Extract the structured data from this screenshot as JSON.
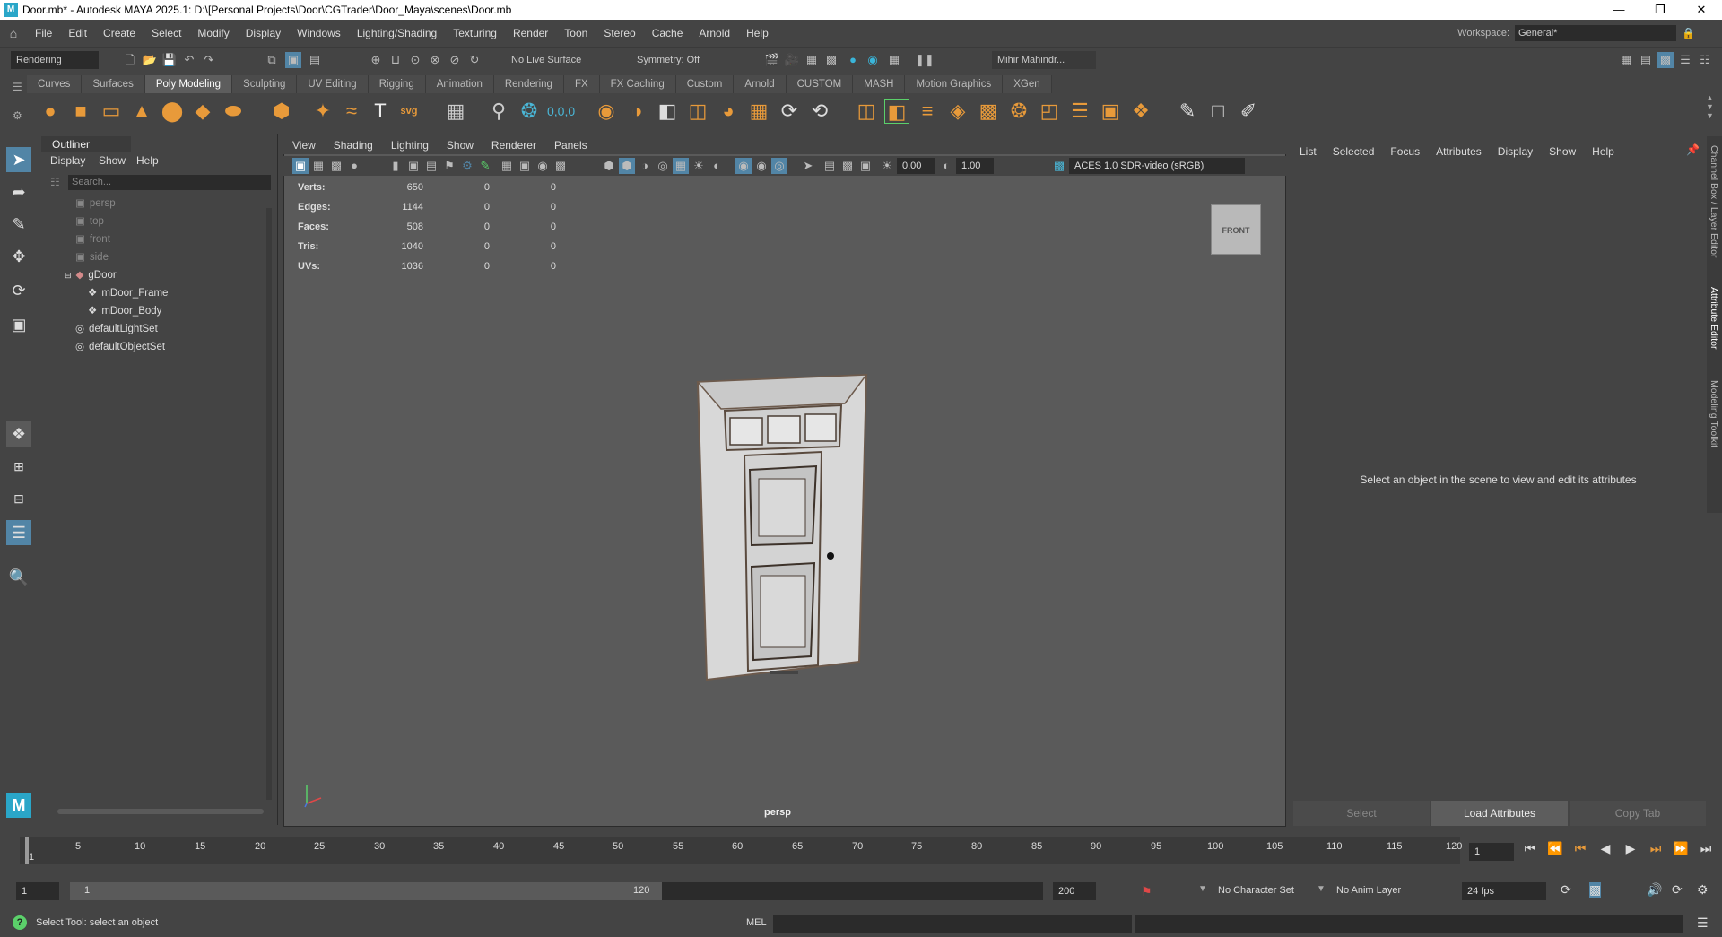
{
  "title": "Door.mb* - Autodesk MAYA 2025.1: D:\\[Personal Projects\\Door\\CGTrader\\Door_Maya\\scenes\\Door.mb",
  "menus": [
    "File",
    "Edit",
    "Create",
    "Select",
    "Modify",
    "Display",
    "Windows",
    "Lighting/Shading",
    "Texturing",
    "Render",
    "Toon",
    "Stereo",
    "Cache",
    "Arnold",
    "Help"
  ],
  "workspace": {
    "label": "Workspace:",
    "value": "General*"
  },
  "status": {
    "menuset": "Rendering",
    "live_surface": "No Live Surface",
    "symmetry": "Symmetry: Off",
    "user": "Mihir Mahindr..."
  },
  "shelf_tabs": [
    "Curves",
    "Surfaces",
    "Poly Modeling",
    "Sculpting",
    "UV Editing",
    "Rigging",
    "Animation",
    "Rendering",
    "FX",
    "FX Caching",
    "Custom",
    "Arnold",
    "CUSTOM",
    "MASH",
    "Motion Graphics",
    "XGen"
  ],
  "shelf_active": "Poly Modeling",
  "outliner": {
    "title": "Outliner",
    "menus": [
      "Display",
      "Show",
      "Help"
    ],
    "search_placeholder": "Search...",
    "items": [
      {
        "label": "persp",
        "dim": true
      },
      {
        "label": "top",
        "dim": true
      },
      {
        "label": "front",
        "dim": true
      },
      {
        "label": "side",
        "dim": true
      },
      {
        "label": "gDoor",
        "dim": false
      },
      {
        "label": "mDoor_Frame",
        "dim": false
      },
      {
        "label": "mDoor_Body",
        "dim": false
      },
      {
        "label": "defaultLightSet",
        "dim": false
      },
      {
        "label": "defaultObjectSet",
        "dim": false
      }
    ]
  },
  "viewport": {
    "menus": [
      "View",
      "Shading",
      "Lighting",
      "Show",
      "Renderer",
      "Panels"
    ],
    "exposure": "0.00",
    "gamma": "1.00",
    "color_space": "ACES 1.0 SDR-video (sRGB)",
    "hud": [
      {
        "label": "Verts:",
        "v1": "650",
        "v2": "0",
        "v3": "0"
      },
      {
        "label": "Edges:",
        "v1": "1144",
        "v2": "0",
        "v3": "0"
      },
      {
        "label": "Faces:",
        "v1": "508",
        "v2": "0",
        "v3": "0"
      },
      {
        "label": "Tris:",
        "v1": "1040",
        "v2": "0",
        "v3": "0"
      },
      {
        "label": "UVs:",
        "v1": "1036",
        "v2": "0",
        "v3": "0"
      }
    ],
    "viewcube": "FRONT",
    "camera": "persp"
  },
  "attribute_editor": {
    "menus": [
      "List",
      "Selected",
      "Focus",
      "Attributes",
      "Display",
      "Show",
      "Help"
    ],
    "message": "Select an object in the scene to view and edit its attributes",
    "buttons": [
      "Select",
      "Load Attributes",
      "Copy Tab"
    ]
  },
  "side_tabs": [
    "Channel Box / Layer Editor",
    "Attribute Editor",
    "Modeling Toolkit"
  ],
  "timeline": {
    "ticks": [
      "1",
      "5",
      "10",
      "15",
      "20",
      "25",
      "30",
      "35",
      "40",
      "45",
      "50",
      "55",
      "60",
      "65",
      "70",
      "75",
      "80",
      "85",
      "90",
      "95",
      "100",
      "105",
      "110",
      "115",
      "120"
    ],
    "current": "1"
  },
  "range": {
    "start": "1",
    "inner_start": "1",
    "inner_end": "120",
    "end": "200",
    "char_set": "No Character Set",
    "anim_layer": "No Anim Layer",
    "fps": "24 fps"
  },
  "command": {
    "help": "Select Tool: select an object",
    "lang": "MEL"
  }
}
